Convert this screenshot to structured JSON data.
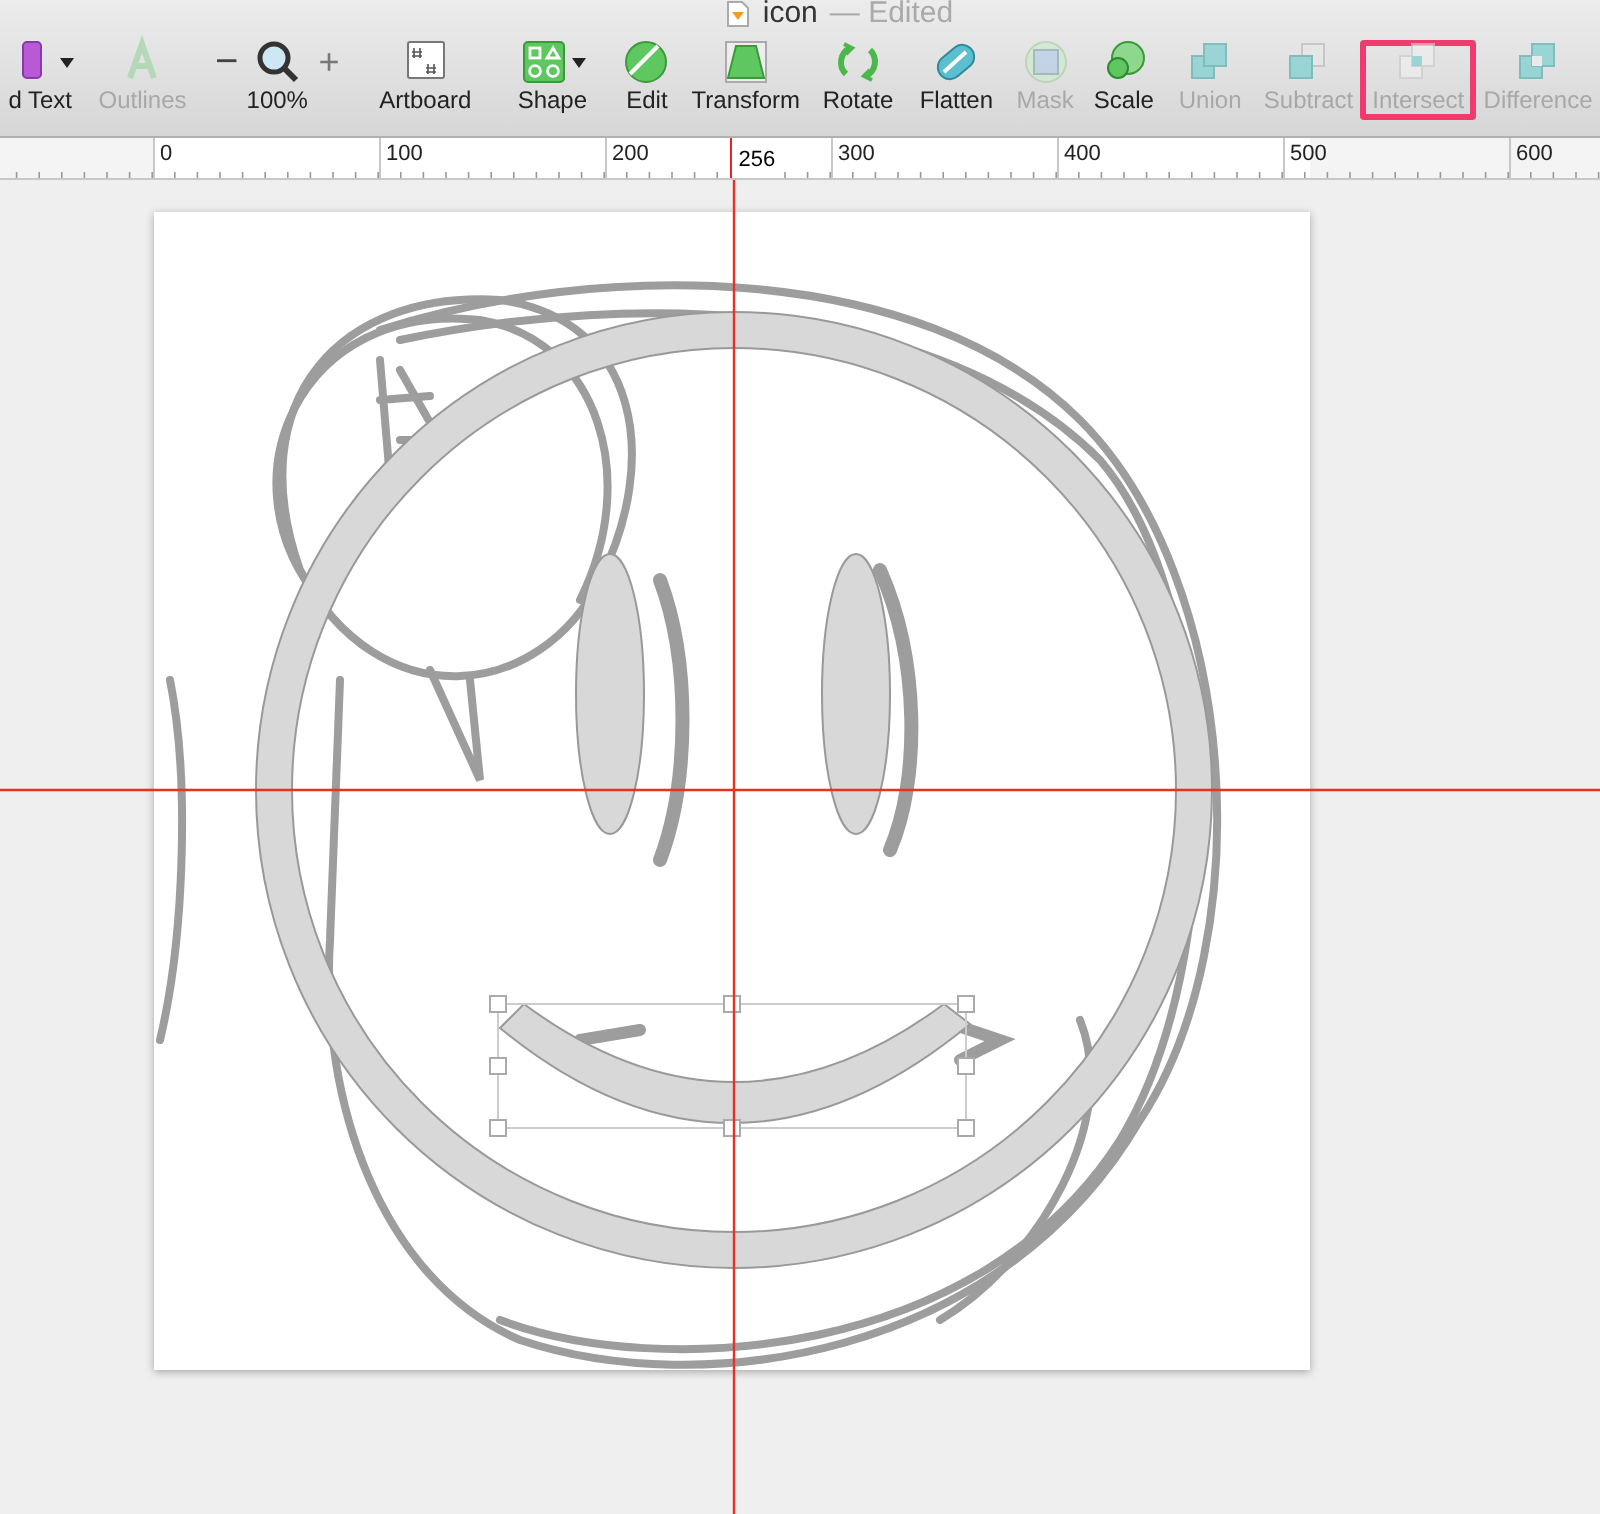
{
  "window": {
    "title": "icon",
    "status": "— Edited"
  },
  "toolbar": [
    {
      "label": "d Text",
      "kind": "text",
      "disabled": false,
      "dropdown": true,
      "highlighted": false
    },
    {
      "label": "Outlines",
      "kind": "outlines",
      "disabled": true,
      "dropdown": false,
      "highlighted": false
    },
    {
      "label": "100%",
      "kind": "zoom",
      "disabled": false,
      "highlighted": false,
      "minus": "−",
      "plus": "+"
    },
    {
      "label": "Artboard",
      "kind": "artboard",
      "disabled": false,
      "dropdown": false,
      "highlighted": false
    },
    {
      "label": "Shape",
      "kind": "shape",
      "disabled": false,
      "dropdown": true,
      "highlighted": false
    },
    {
      "label": "Edit",
      "kind": "edit",
      "disabled": false,
      "dropdown": false,
      "highlighted": false
    },
    {
      "label": "Transform",
      "kind": "transform",
      "disabled": false,
      "dropdown": false,
      "highlighted": false
    },
    {
      "label": "Rotate",
      "kind": "rotate",
      "disabled": false,
      "dropdown": false,
      "highlighted": false
    },
    {
      "label": "Flatten",
      "kind": "flatten",
      "disabled": false,
      "dropdown": false,
      "highlighted": false
    },
    {
      "label": "Mask",
      "kind": "mask",
      "disabled": true,
      "dropdown": false,
      "highlighted": false
    },
    {
      "label": "Scale",
      "kind": "scale",
      "disabled": false,
      "dropdown": false,
      "highlighted": false
    },
    {
      "label": "Union",
      "kind": "union",
      "disabled": true,
      "dropdown": false,
      "highlighted": false
    },
    {
      "label": "Subtract",
      "kind": "subtract",
      "disabled": true,
      "dropdown": false,
      "highlighted": false
    },
    {
      "label": "Intersect",
      "kind": "intersect",
      "disabled": true,
      "dropdown": false,
      "highlighted": true
    },
    {
      "label": "Difference",
      "kind": "difference",
      "disabled": true,
      "dropdown": false,
      "highlighted": false
    }
  ],
  "ruler": {
    "labels": [
      {
        "text": "0",
        "selected": false
      },
      {
        "text": "100",
        "selected": false
      },
      {
        "text": "200",
        "selected": false
      },
      {
        "text": "256",
        "selected": true
      },
      {
        "text": "300",
        "selected": false
      },
      {
        "text": "400",
        "selected": false
      },
      {
        "text": "500",
        "selected": false
      },
      {
        "text": "600",
        "selected": false
      }
    ]
  }
}
